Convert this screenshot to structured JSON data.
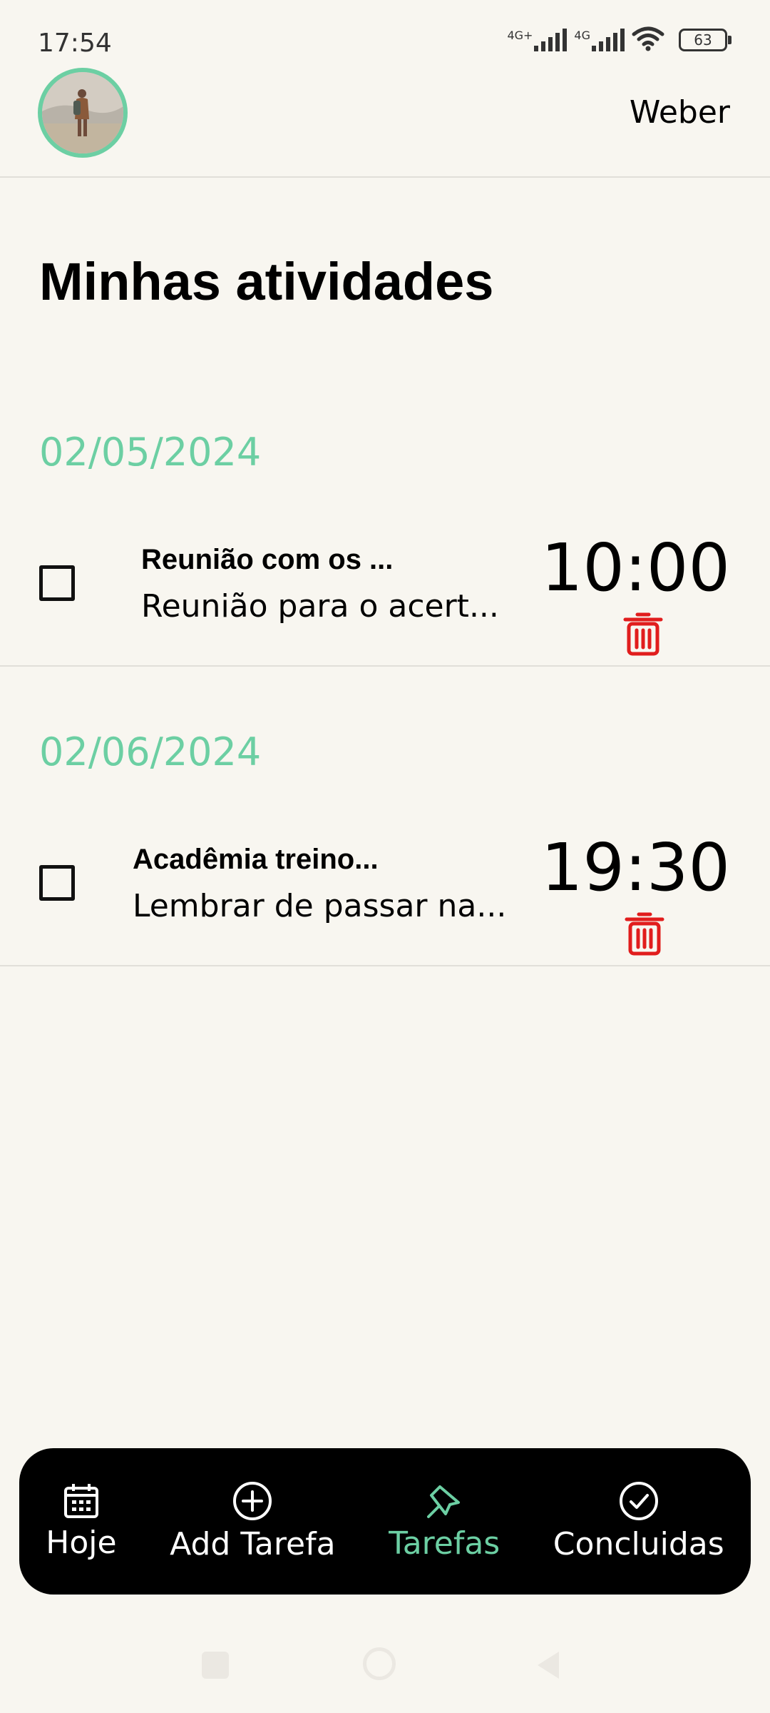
{
  "status": {
    "time": "17:54",
    "net1_label": "4G+",
    "net2_label": "4G",
    "battery": "63"
  },
  "header": {
    "username": "Weber"
  },
  "page": {
    "title": "Minhas atividades"
  },
  "groups": [
    {
      "date": "02/05/2024",
      "items": [
        {
          "title": "Reunião com os ...",
          "description": "Reunião para o acert...",
          "time": "10:00",
          "done": false
        }
      ]
    },
    {
      "date": "02/06/2024",
      "items": [
        {
          "title": "Acadêmia treino...",
          "description": "Lembrar de passar na...",
          "time": "19:30",
          "done": false
        }
      ]
    }
  ],
  "nav": {
    "items": [
      {
        "label": "Hoje",
        "icon": "calendar-icon"
      },
      {
        "label": "Add Tarefa",
        "icon": "plus-circle-icon"
      },
      {
        "label": "Tarefas",
        "icon": "pin-icon",
        "active": true
      },
      {
        "label": "Concluidas",
        "icon": "check-circle-icon"
      }
    ]
  },
  "colors": {
    "accent": "#6ccfa3",
    "delete": "#e11d1d",
    "background": "#f8f6f0"
  }
}
